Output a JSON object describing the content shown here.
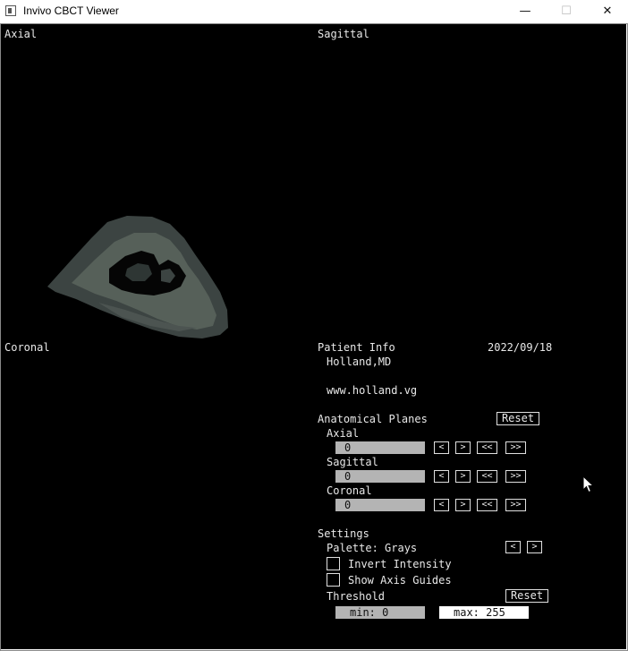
{
  "window": {
    "title": "Invivo CBCT Viewer",
    "minimize": "—",
    "maximize": "☐",
    "close": "✕"
  },
  "views": {
    "axial": "Axial",
    "sagittal": "Sagittal",
    "coronal": "Coronal"
  },
  "patient": {
    "heading": "Patient Info",
    "date": "2022/09/18",
    "name": "Holland,MD",
    "website": "www.holland.vg"
  },
  "planes": {
    "heading": "Anatomical Planes",
    "reset": "Reset",
    "items": [
      {
        "label": "Axial",
        "value": "0"
      },
      {
        "label": "Sagittal",
        "value": "0"
      },
      {
        "label": "Coronal",
        "value": "0"
      }
    ],
    "nav": {
      "prev": "<",
      "next": ">",
      "first": "<<",
      "last": ">>"
    }
  },
  "settings": {
    "heading": "Settings",
    "palette": "Palette: Grays",
    "palette_prev": "<",
    "palette_next": ">",
    "invert": "Invert Intensity",
    "invert_checked": false,
    "axis_guides": "Show Axis Guides",
    "axis_guides_checked": false,
    "threshold": "Threshold",
    "threshold_reset": "Reset",
    "min": "min: 0",
    "max": "max: 255"
  },
  "colors": {
    "canvas": "#000000",
    "text": "#e8e8e8",
    "field": "#b4b4b4",
    "scan_dark": "#3a4240",
    "scan_light": "#5a625f"
  }
}
